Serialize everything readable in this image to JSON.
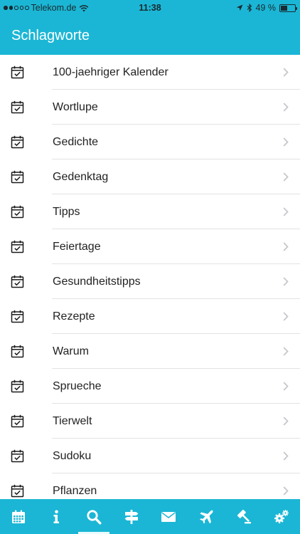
{
  "status_bar": {
    "carrier": "Telekom.de",
    "time": "11:38",
    "battery": "49 %",
    "battery_level": 0.49
  },
  "header": {
    "title": "Schlagworte"
  },
  "list": {
    "items": [
      {
        "label": "100-jaehriger Kalender"
      },
      {
        "label": "Wortlupe"
      },
      {
        "label": "Gedichte"
      },
      {
        "label": "Gedenktag"
      },
      {
        "label": "Tipps"
      },
      {
        "label": "Feiertage"
      },
      {
        "label": "Gesundheitstipps"
      },
      {
        "label": "Rezepte"
      },
      {
        "label": "Warum"
      },
      {
        "label": "Sprueche"
      },
      {
        "label": "Tierwelt"
      },
      {
        "label": "Sudoku"
      },
      {
        "label": "Pflanzen"
      }
    ]
  },
  "tabbar": {
    "tabs": [
      {
        "icon": "calendar-icon",
        "active": false
      },
      {
        "icon": "info-icon",
        "active": false
      },
      {
        "icon": "search-icon",
        "active": true
      },
      {
        "icon": "signpost-icon",
        "active": false
      },
      {
        "icon": "envelope-icon",
        "active": false
      },
      {
        "icon": "airplane-icon",
        "active": false
      },
      {
        "icon": "gavel-icon",
        "active": false
      },
      {
        "icon": "gears-icon",
        "active": false
      }
    ]
  },
  "colors": {
    "accent": "#1bb6d5",
    "text": "#222222",
    "separator": "#e3e3e3",
    "chevron": "#c7c7cc"
  }
}
